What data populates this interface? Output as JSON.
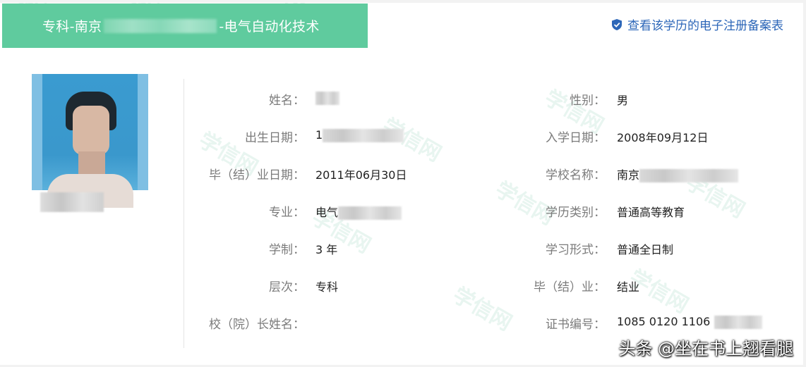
{
  "header": {
    "title_prefix": "专科-南京",
    "title_suffix": "-电气自动化技术",
    "verify_link": "查看该学历的电子注册备案表",
    "banner_color": "#5fcb9e",
    "link_color": "#2c66b8"
  },
  "watermark_text": "学信网",
  "left_fields": [
    {
      "label": "姓名：",
      "value": ""
    },
    {
      "label": "出生日期：",
      "value": "1"
    },
    {
      "label": "毕（结）业日期：",
      "value": "2011年06月30日"
    },
    {
      "label": "专业：",
      "value": "电气"
    },
    {
      "label": "学制：",
      "value": "3 年"
    },
    {
      "label": "层次：",
      "value": "专科"
    },
    {
      "label": "校（院）长姓名：",
      "value": ""
    }
  ],
  "right_fields": [
    {
      "label": "性别：",
      "value": "男"
    },
    {
      "label": "入学日期：",
      "value": "2008年09月12日"
    },
    {
      "label": "学校名称：",
      "value": "南京"
    },
    {
      "label": "学历类别：",
      "value": "普通高等教育"
    },
    {
      "label": "学习形式：",
      "value": "普通全日制"
    },
    {
      "label": "毕（结）业：",
      "value": "结业"
    },
    {
      "label": "证书编号：",
      "value": "1085 0120 1106"
    }
  ],
  "credit": "头条 @坐在书上翘看腿"
}
